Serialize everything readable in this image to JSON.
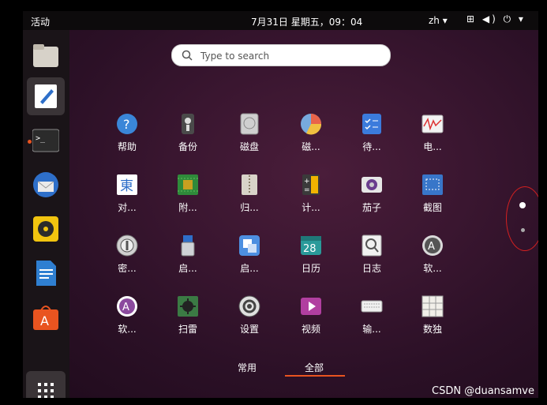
{
  "topbar": {
    "activities": "活动",
    "clock": "7月31日 星期五，09：04",
    "lang": "zh ▾",
    "system_glyphs": "⊞ ◀) ⏻ ▾"
  },
  "search": {
    "placeholder": "Type to search"
  },
  "apps": [
    {
      "label": "帮助",
      "icon": "help-icon",
      "color": "#3a86d8"
    },
    {
      "label": "备份",
      "icon": "backup-icon",
      "color": "#4a4a4a"
    },
    {
      "label": "磁盘",
      "icon": "disk-icon",
      "color": "#cfcfcf"
    },
    {
      "label": "磁...",
      "icon": "disk-usage-icon",
      "color": "#e8644a"
    },
    {
      "label": "待...",
      "icon": "todo-icon",
      "color": "#3b7bdc"
    },
    {
      "label": "电...",
      "icon": "power-stats-icon",
      "color": "#f3f3f3"
    },
    {
      "label": "对...",
      "icon": "character-map-icon",
      "color": "#ffffff"
    },
    {
      "label": "附...",
      "icon": "hardware-icon",
      "color": "#2f8a3a"
    },
    {
      "label": "归...",
      "icon": "archive-icon",
      "color": "#d8d3c8"
    },
    {
      "label": "计...",
      "icon": "calculator-icon",
      "color": "#3a3a3a"
    },
    {
      "label": "茄子",
      "icon": "cheese-icon",
      "color": "#e6e6e6"
    },
    {
      "label": "截图",
      "icon": "screenshot-icon",
      "color": "#3876c9"
    },
    {
      "label": "密...",
      "icon": "passwords-icon",
      "color": "#d0d0d0"
    },
    {
      "label": "启...",
      "icon": "usb-creator-icon",
      "color": "#cfd2d6"
    },
    {
      "label": "启...",
      "icon": "startup-apps-icon",
      "color": "#4d8fe0"
    },
    {
      "label": "日历",
      "icon": "calendar-icon",
      "color": "#2a9a9a"
    },
    {
      "label": "日志",
      "icon": "logs-icon",
      "color": "#f1f1f1"
    },
    {
      "label": "软...",
      "icon": "software-updater-icon",
      "color": "#d9d9d9"
    },
    {
      "label": "软...",
      "icon": "software-properties-icon",
      "color": "#8b4a9e"
    },
    {
      "label": "扫雷",
      "icon": "mines-icon",
      "color": "#3b7a44"
    },
    {
      "label": "设置",
      "icon": "settings-icon",
      "color": "#d9d9d9"
    },
    {
      "label": "视频",
      "icon": "videos-icon",
      "color": "#b13fa0"
    },
    {
      "label": "输...",
      "icon": "keyboard-icon",
      "color": "#f0f0f0"
    },
    {
      "label": "数独",
      "icon": "sudoku-icon",
      "color": "#f1efe9"
    }
  ],
  "calendar_day": "28",
  "tabs": {
    "frequent": "常用",
    "all": "全部"
  },
  "dock": [
    {
      "name": "files-icon",
      "color": "#d7d2c9"
    },
    {
      "name": "text-editor-icon",
      "color": "#ffffff"
    },
    {
      "name": "terminal-icon",
      "color": "#2b2b2b"
    },
    {
      "name": "thunderbird-icon",
      "color": "#2e6fc9"
    },
    {
      "name": "rhythmbox-icon",
      "color": "#f1c40f"
    },
    {
      "name": "libreoffice-writer-icon",
      "color": "#2f7fd1"
    },
    {
      "name": "ubuntu-software-icon",
      "color": "#e95420"
    }
  ],
  "watermark": "CSDN @duansamve"
}
